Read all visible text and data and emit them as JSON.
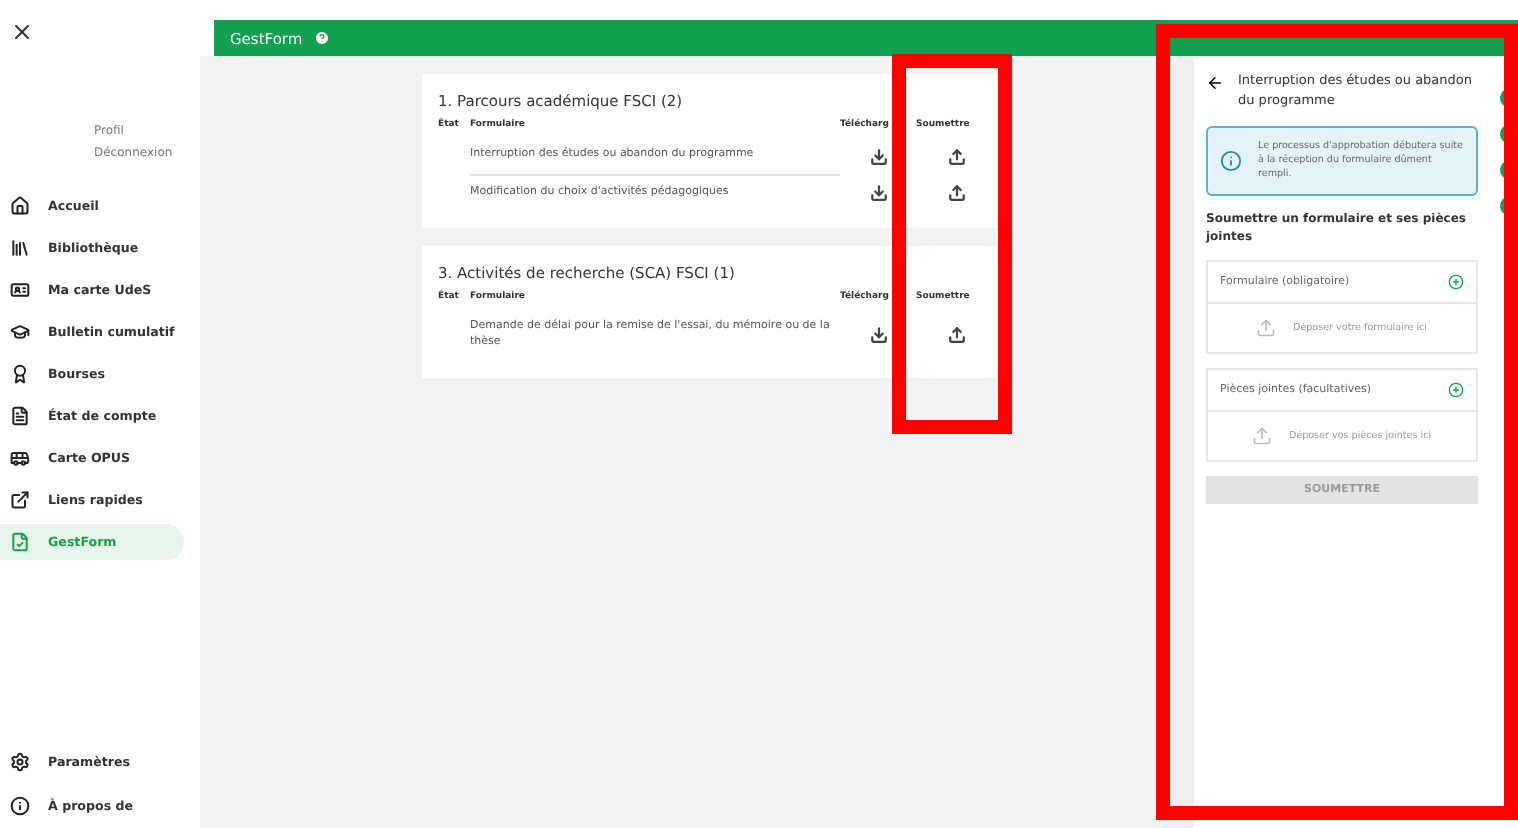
{
  "sidebar": {
    "profile_links": [
      "Profil",
      "Déconnexion"
    ],
    "items": [
      {
        "label": "Accueil",
        "selected": false
      },
      {
        "label": "Bibliothèque",
        "selected": false
      },
      {
        "label": "Ma carte UdeS",
        "selected": false
      },
      {
        "label": "Bulletin cumulatif",
        "selected": false
      },
      {
        "label": "Bourses",
        "selected": false
      },
      {
        "label": "État de compte",
        "selected": false
      },
      {
        "label": "Carte OPUS",
        "selected": false
      },
      {
        "label": "Liens rapides",
        "selected": false
      },
      {
        "label": "GestForm",
        "selected": true
      }
    ],
    "bottom_items": [
      {
        "label": "Paramètres"
      },
      {
        "label": "À propos de"
      }
    ]
  },
  "header": {
    "title": "GestForm"
  },
  "sections": [
    {
      "title": "1. Parcours académique FSCI (2)",
      "columns": [
        "État",
        "Formulaire",
        "Télécharg",
        "Soumettre"
      ],
      "rows": [
        {
          "form": "Interruption des études ou abandon du programme"
        },
        {
          "form": "Modification du choix d'activités pédagogiques"
        }
      ]
    },
    {
      "title": "3. Activités de recherche (SCA) FSCI (1)",
      "columns": [
        "État",
        "Formulaire",
        "Télécharg",
        "Soumettre"
      ],
      "rows": [
        {
          "form": "Demande de délai pour la remise de l'essai, du mémoire ou de la thèse"
        }
      ]
    }
  ],
  "drawer": {
    "title": "Interruption des études ou abandon du programme",
    "info": "Le processus d'approbation débutera suite à la réception du formulaire dûment rempli.",
    "heading": "Soumettre un formulaire et ses pièces jointes",
    "uploads": [
      {
        "label": "Formulaire (obligatoire)",
        "drop": "Déposer votre formulaire ici"
      },
      {
        "label": "Pièces jointes (facultatives)",
        "drop": "Déposer vos pièces jointes ici"
      }
    ],
    "submit": {
      "label": "SOUMETTRE",
      "disabled": true
    }
  }
}
